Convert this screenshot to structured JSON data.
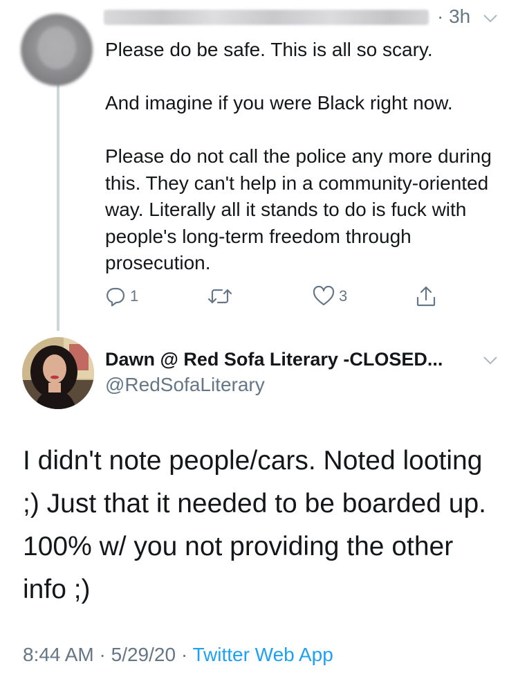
{
  "reply": {
    "time": "· 3h",
    "paragraphs": [
      "Please do be safe. This is all so scary.",
      "And imagine if you were Black right now.",
      "Please do not call the police any more during this. They can't help in a community-oriented way. Literally all it stands to do is fuck with people's long-term freedom through prosecution."
    ],
    "actions": {
      "reply_count": "1",
      "retweet_count": "",
      "like_count": "3"
    }
  },
  "tweet": {
    "display_name": "Dawn @ Red Sofa Literary -CLOSED...",
    "handle": "@RedSofaLiterary",
    "text": "I didn't note people/cars. Noted looting ;)  Just that it needed to be boarded up. 100% w/ you not providing the other info ;)",
    "time": "8:44 AM",
    "separator": "·",
    "date": "5/29/20",
    "app": "Twitter Web App"
  },
  "colors": {
    "text_primary": "#14171a",
    "text_secondary": "#657786",
    "link": "#1da1f2",
    "thread_line": "#ccd6dd"
  },
  "icons": [
    "reply-icon",
    "retweet-icon",
    "like-icon",
    "share-icon",
    "chevron-down-icon"
  ]
}
